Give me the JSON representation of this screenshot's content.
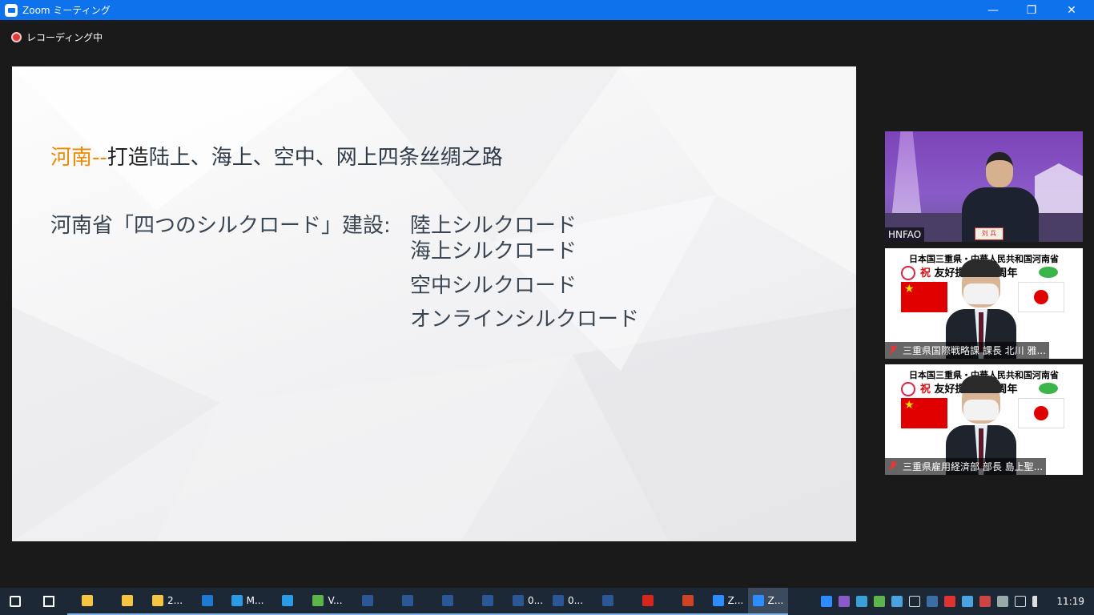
{
  "window": {
    "title": "Zoom ミーティング",
    "minimize": "—",
    "restore": "❐",
    "close": "✕"
  },
  "recording": {
    "label": "レコーディング中"
  },
  "slide": {
    "headline_part1": "河南",
    "headline_part2": "--",
    "headline_part3": "打造",
    "headline_part4": "陆上、海上、空中、网上四条丝绸之路",
    "subhead": "河南省「四つのシルクロード」建設:",
    "routes": [
      "陸上シルクロード",
      "海上シルクロード",
      "空中シルクロード",
      "オンラインシルクロード"
    ]
  },
  "videos": [
    {
      "label": "HNFAO",
      "name_card": "刘 兵"
    },
    {
      "label": "三重県国際戦略課  課長  北川  雅...",
      "banner1": "日本国三重県・中華人民共和国河南省",
      "banner2_iwai": "祝",
      "banner2_text": "友好提携３５周年"
    },
    {
      "label": "三重県雇用経済部  部長  島上聖...",
      "banner1": "日本国三重県・中華人民共和国河南省",
      "banner2_iwai": "祝",
      "banner2_text": "友好提携３５周年"
    }
  ],
  "taskbar": {
    "items": [
      {
        "name": "start",
        "label": "",
        "icon": "windows-icon",
        "color": "#ffffff"
      },
      {
        "name": "task-view",
        "label": "",
        "icon": "task-view-icon",
        "color": "#ffffff"
      },
      {
        "name": "explorer-1",
        "label": "",
        "icon": "folder-icon",
        "color": "#f5c542"
      },
      {
        "name": "explorer-2",
        "label": "",
        "icon": "folder-icon",
        "color": "#f5c542"
      },
      {
        "name": "explorer-3",
        "label": "2...",
        "icon": "folder-icon",
        "color": "#f5c542"
      },
      {
        "name": "outlook",
        "label": "",
        "icon": "outlook-icon",
        "color": "#1f78d1"
      },
      {
        "name": "ie-1",
        "label": "M...",
        "icon": "ie-icon",
        "color": "#2b9be8"
      },
      {
        "name": "ie-2",
        "label": "",
        "icon": "ie-icon",
        "color": "#2b9be8"
      },
      {
        "name": "v-app",
        "label": "V...",
        "icon": "green-app-icon",
        "color": "#5bb548"
      },
      {
        "name": "word-1",
        "label": "",
        "icon": "word-icon",
        "color": "#2b5797"
      },
      {
        "name": "word-2",
        "label": "",
        "icon": "word-icon",
        "color": "#2b5797"
      },
      {
        "name": "word-3",
        "label": "",
        "icon": "word-icon",
        "color": "#2b5797"
      },
      {
        "name": "word-4",
        "label": "",
        "icon": "word-icon",
        "color": "#2b5797"
      },
      {
        "name": "word-5",
        "label": "0...",
        "icon": "word-icon",
        "color": "#2b5797"
      },
      {
        "name": "word-6",
        "label": "0...",
        "icon": "word-icon",
        "color": "#2b5797"
      },
      {
        "name": "word-7",
        "label": "",
        "icon": "word-icon",
        "color": "#2b5797"
      },
      {
        "name": "acrobat",
        "label": "",
        "icon": "pdf-icon",
        "color": "#d9261c"
      },
      {
        "name": "powerpoint",
        "label": "",
        "icon": "powerpoint-icon",
        "color": "#d04423"
      },
      {
        "name": "zoom-1",
        "label": "Z...",
        "icon": "zoom-icon",
        "color": "#2d8cff"
      },
      {
        "name": "zoom-2",
        "label": "Z...",
        "icon": "zoom-icon",
        "color": "#2d8cff"
      }
    ],
    "clock": "11:19"
  }
}
